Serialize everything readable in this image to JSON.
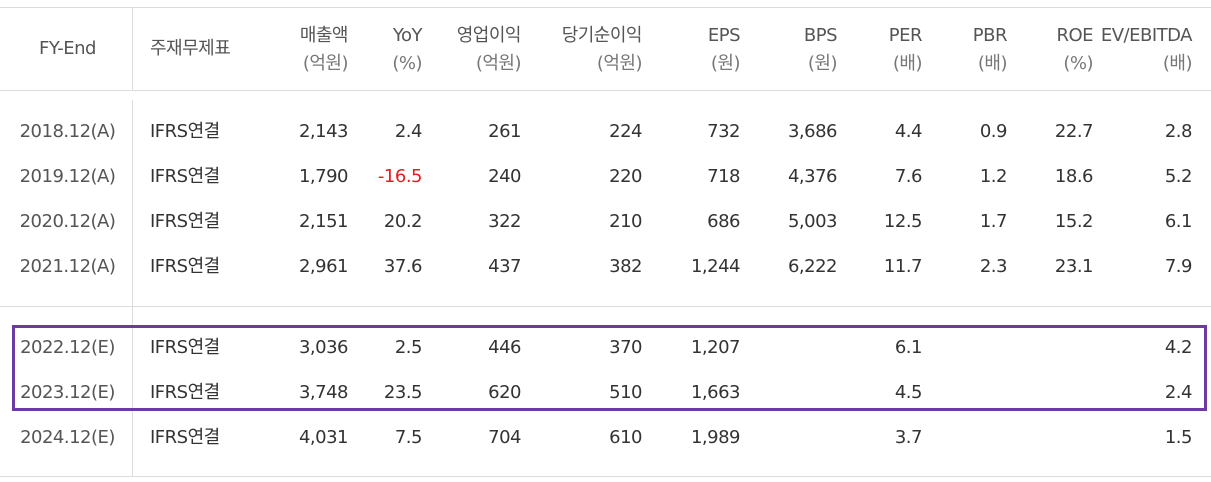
{
  "headers": [
    {
      "key": "fy",
      "label": "FY-End",
      "sub": ""
    },
    {
      "key": "std",
      "label": "주재무제표",
      "sub": ""
    },
    {
      "key": "rev",
      "label": "매출액",
      "sub": "(억원)"
    },
    {
      "key": "yoy",
      "label": "YoY",
      "sub": "(%)"
    },
    {
      "key": "op",
      "label": "영업이익",
      "sub": "(억원)"
    },
    {
      "key": "net",
      "label": "당기순이익",
      "sub": "(억원)"
    },
    {
      "key": "eps",
      "label": "EPS",
      "sub": "(원)"
    },
    {
      "key": "bps",
      "label": "BPS",
      "sub": "(원)"
    },
    {
      "key": "per",
      "label": "PER",
      "sub": "(배)"
    },
    {
      "key": "pbr",
      "label": "PBR",
      "sub": "(배)"
    },
    {
      "key": "roe",
      "label": "ROE",
      "sub": "(%)"
    },
    {
      "key": "ev",
      "label": "EV/EBITDA",
      "sub": "(배)"
    }
  ],
  "rows": [
    {
      "fy": "2018.12(A)",
      "std": "IFRS연결",
      "rev": "2,143",
      "yoy": "2.4",
      "op": "261",
      "net": "224",
      "eps": "732",
      "bps": "3,686",
      "per": "4.4",
      "pbr": "0.9",
      "roe": "22.7",
      "ev": "2.8"
    },
    {
      "fy": "2019.12(A)",
      "std": "IFRS연결",
      "rev": "1,790",
      "yoy": "-16.5",
      "op": "240",
      "net": "220",
      "eps": "718",
      "bps": "4,376",
      "per": "7.6",
      "pbr": "1.2",
      "roe": "18.6",
      "ev": "5.2"
    },
    {
      "fy": "2020.12(A)",
      "std": "IFRS연결",
      "rev": "2,151",
      "yoy": "20.2",
      "op": "322",
      "net": "210",
      "eps": "686",
      "bps": "5,003",
      "per": "12.5",
      "pbr": "1.7",
      "roe": "15.2",
      "ev": "6.1"
    },
    {
      "fy": "2021.12(A)",
      "std": "IFRS연결",
      "rev": "2,961",
      "yoy": "37.6",
      "op": "437",
      "net": "382",
      "eps": "1,244",
      "bps": "6,222",
      "per": "11.7",
      "pbr": "2.3",
      "roe": "23.1",
      "ev": "7.9"
    },
    {
      "fy": "2022.12(E)",
      "std": "IFRS연결",
      "rev": "3,036",
      "yoy": "2.5",
      "op": "446",
      "net": "370",
      "eps": "1,207",
      "bps": "",
      "per": "6.1",
      "pbr": "",
      "roe": "",
      "ev": "4.2"
    },
    {
      "fy": "2023.12(E)",
      "std": "IFRS연결",
      "rev": "3,748",
      "yoy": "23.5",
      "op": "620",
      "net": "510",
      "eps": "1,663",
      "bps": "",
      "per": "4.5",
      "pbr": "",
      "roe": "",
      "ev": "2.4"
    },
    {
      "fy": "2024.12(E)",
      "std": "IFRS연결",
      "rev": "4,031",
      "yoy": "7.5",
      "op": "704",
      "net": "610",
      "eps": "1,989",
      "bps": "",
      "per": "3.7",
      "pbr": "",
      "roe": "",
      "ev": "1.5"
    }
  ],
  "colors": {
    "negative": "#e02020",
    "highlight_border": "#6c3aa0",
    "grid": "#dcdcdc"
  }
}
